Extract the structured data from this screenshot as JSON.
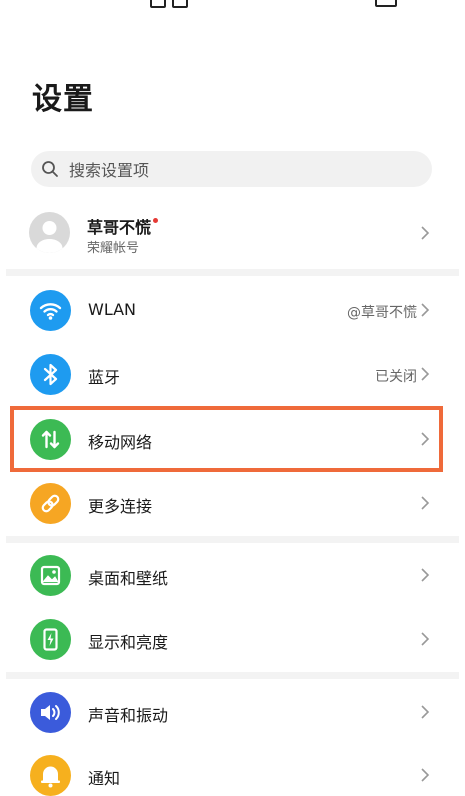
{
  "page_title": "设置",
  "search": {
    "placeholder": "搜索设置项",
    "icon": "search-icon"
  },
  "account": {
    "name": "草哥不慌",
    "subtitle": "荣耀帐号",
    "notification": true
  },
  "items": [
    {
      "key": "wlan",
      "label": "WLAN",
      "value": "@草哥不慌",
      "icon": "wifi-icon",
      "color": "#1e9bf0"
    },
    {
      "key": "bluetooth",
      "label": "蓝牙",
      "value": "已关闭",
      "icon": "bluetooth-icon",
      "color": "#1e9bf0"
    },
    {
      "key": "mobile-network",
      "label": "移动网络",
      "value": "",
      "icon": "mobile-data-icon",
      "color": "#3cba54",
      "highlighted": true
    },
    {
      "key": "more-connections",
      "label": "更多连接",
      "value": "",
      "icon": "link-icon",
      "color": "#f6a623"
    },
    {
      "key": "wallpaper",
      "label": "桌面和壁纸",
      "value": "",
      "icon": "image-icon",
      "color": "#3cba54"
    },
    {
      "key": "display",
      "label": "显示和亮度",
      "value": "",
      "icon": "brightness-phone-icon",
      "color": "#3cba54"
    },
    {
      "key": "sound",
      "label": "声音和振动",
      "value": "",
      "icon": "speaker-icon",
      "color": "#3b5bdb"
    },
    {
      "key": "notifications",
      "label": "通知",
      "value": "",
      "icon": "bell-icon",
      "color": "#f6b01e"
    }
  ],
  "colors": {
    "highlight": "#ef6a3a",
    "accent_blue": "#1e9bf0",
    "green": "#3cba54",
    "orange": "#f6a623",
    "indigo": "#3b5bdb"
  }
}
